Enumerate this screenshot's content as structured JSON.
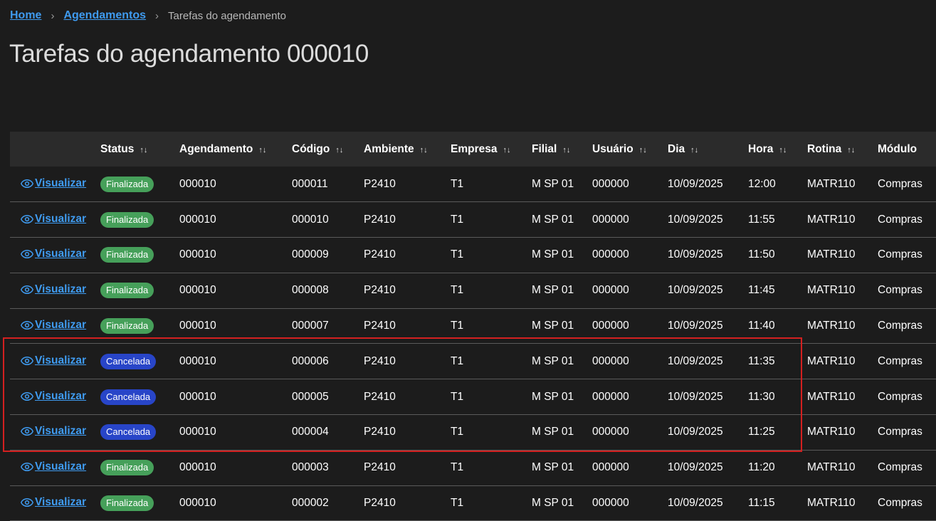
{
  "breadcrumb": {
    "home": "Home",
    "agendamentos": "Agendamentos",
    "current": "Tarefas do agendamento"
  },
  "page_title": "Tarefas do agendamento 000010",
  "table": {
    "headers": [
      "",
      "Status",
      "Agendamento",
      "Código",
      "Ambiente",
      "Empresa",
      "Filial",
      "Usuário",
      "Dia",
      "Hora",
      "Rotina",
      "Módulo"
    ],
    "sortable": [
      false,
      true,
      true,
      true,
      true,
      true,
      true,
      true,
      true,
      true,
      true,
      false
    ],
    "action_label": "Visualizar",
    "rows": [
      {
        "status": "Finalizada",
        "agendamento": "000010",
        "codigo": "000011",
        "ambiente": "P2410",
        "empresa": "T1",
        "filial": "M SP 01",
        "usuario": "000000",
        "dia": "10/09/2025",
        "hora": "12:00",
        "rotina": "MATR110",
        "modulo": "Compras"
      },
      {
        "status": "Finalizada",
        "agendamento": "000010",
        "codigo": "000010",
        "ambiente": "P2410",
        "empresa": "T1",
        "filial": "M SP 01",
        "usuario": "000000",
        "dia": "10/09/2025",
        "hora": "11:55",
        "rotina": "MATR110",
        "modulo": "Compras"
      },
      {
        "status": "Finalizada",
        "agendamento": "000010",
        "codigo": "000009",
        "ambiente": "P2410",
        "empresa": "T1",
        "filial": "M SP 01",
        "usuario": "000000",
        "dia": "10/09/2025",
        "hora": "11:50",
        "rotina": "MATR110",
        "modulo": "Compras"
      },
      {
        "status": "Finalizada",
        "agendamento": "000010",
        "codigo": "000008",
        "ambiente": "P2410",
        "empresa": "T1",
        "filial": "M SP 01",
        "usuario": "000000",
        "dia": "10/09/2025",
        "hora": "11:45",
        "rotina": "MATR110",
        "modulo": "Compras"
      },
      {
        "status": "Finalizada",
        "agendamento": "000010",
        "codigo": "000007",
        "ambiente": "P2410",
        "empresa": "T1",
        "filial": "M SP 01",
        "usuario": "000000",
        "dia": "10/09/2025",
        "hora": "11:40",
        "rotina": "MATR110",
        "modulo": "Compras"
      },
      {
        "status": "Cancelada",
        "agendamento": "000010",
        "codigo": "000006",
        "ambiente": "P2410",
        "empresa": "T1",
        "filial": "M SP 01",
        "usuario": "000000",
        "dia": "10/09/2025",
        "hora": "11:35",
        "rotina": "MATR110",
        "modulo": "Compras"
      },
      {
        "status": "Cancelada",
        "agendamento": "000010",
        "codigo": "000005",
        "ambiente": "P2410",
        "empresa": "T1",
        "filial": "M SP 01",
        "usuario": "000000",
        "dia": "10/09/2025",
        "hora": "11:30",
        "rotina": "MATR110",
        "modulo": "Compras"
      },
      {
        "status": "Cancelada",
        "agendamento": "000010",
        "codigo": "000004",
        "ambiente": "P2410",
        "empresa": "T1",
        "filial": "M SP 01",
        "usuario": "000000",
        "dia": "10/09/2025",
        "hora": "11:25",
        "rotina": "MATR110",
        "modulo": "Compras"
      },
      {
        "status": "Finalizada",
        "agendamento": "000010",
        "codigo": "000003",
        "ambiente": "P2410",
        "empresa": "T1",
        "filial": "M SP 01",
        "usuario": "000000",
        "dia": "10/09/2025",
        "hora": "11:20",
        "rotina": "MATR110",
        "modulo": "Compras"
      },
      {
        "status": "Finalizada",
        "agendamento": "000010",
        "codigo": "000002",
        "ambiente": "P2410",
        "empresa": "T1",
        "filial": "M SP 01",
        "usuario": "000000",
        "dia": "10/09/2025",
        "hora": "11:15",
        "rotina": "MATR110",
        "modulo": "Compras"
      }
    ]
  },
  "colors": {
    "background": "#1c1c1c",
    "header_bg": "#2b2b2b",
    "link": "#3f9bf0",
    "badge_finalizada": "#46a05a",
    "badge_cancelada": "#2845c8",
    "highlight": "#d42020"
  },
  "icons": {
    "view": "eye-icon",
    "sort": "sort-arrows-icon",
    "breadcrumb_separator": "chevron-right-icon"
  }
}
